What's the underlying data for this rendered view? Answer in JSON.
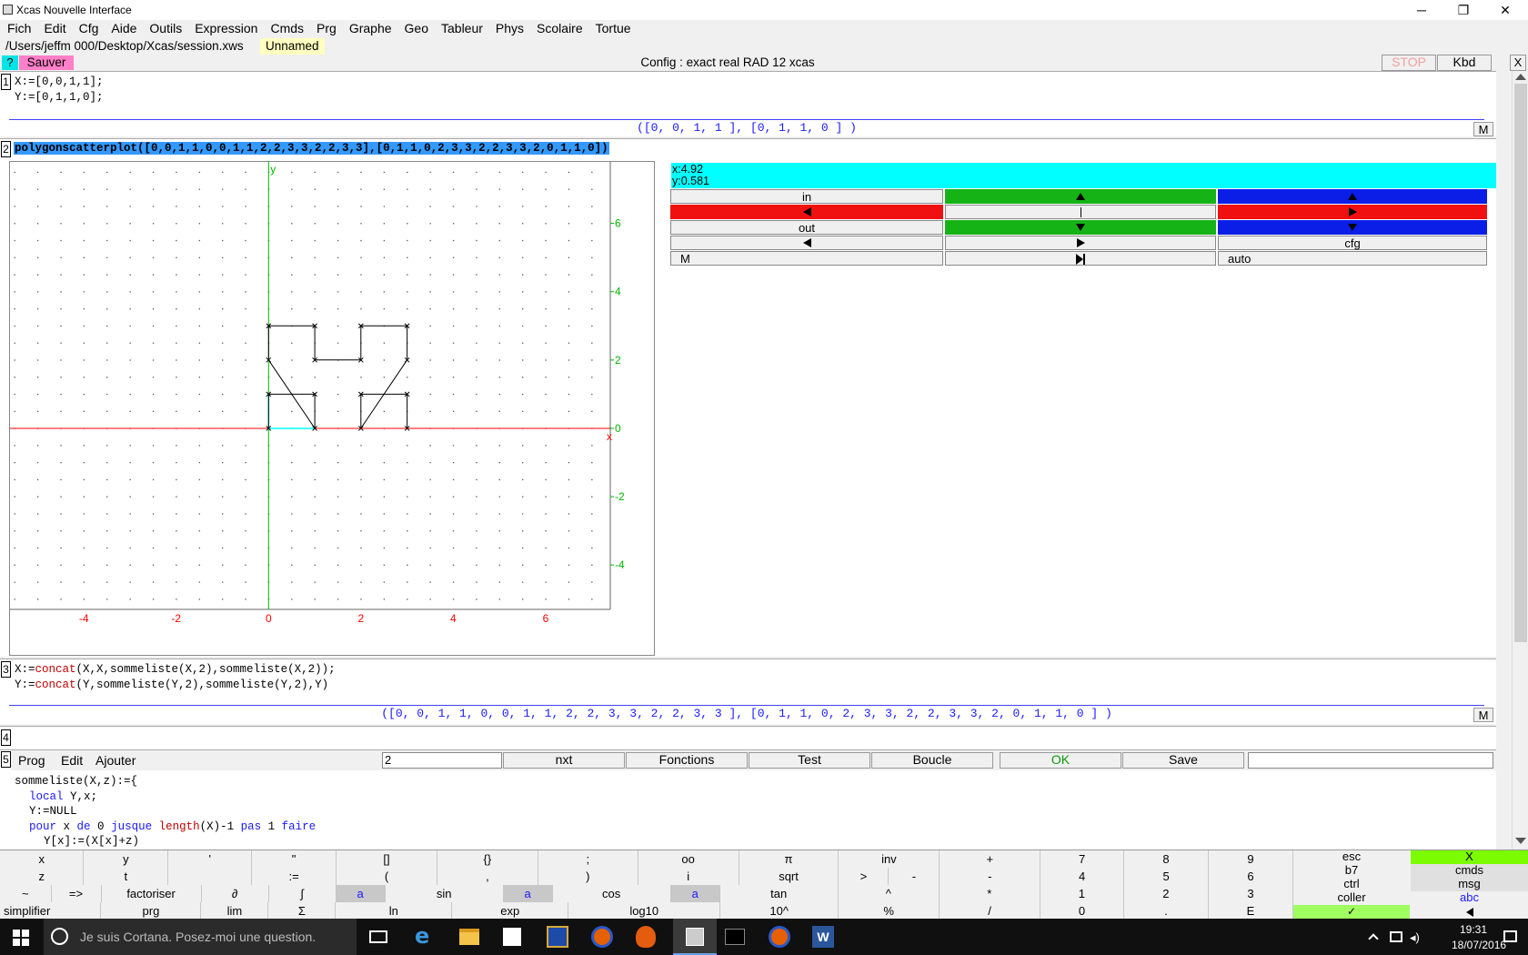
{
  "window": {
    "title": "Xcas Nouvelle Interface",
    "controls": [
      "─",
      "❐",
      "✕"
    ]
  },
  "menu": [
    "Fich",
    "Edit",
    "Cfg",
    "Aide",
    "Outils",
    "Expression",
    "Cmds",
    "Prg",
    "Graphe",
    "Geo",
    "Tableur",
    "Phys",
    "Scolaire",
    "Tortue"
  ],
  "session": {
    "path": "/Users/jeffm  000/Desktop/Xcas/session.xws",
    "name": "Unnamed"
  },
  "config": {
    "help": "?",
    "save": "Sauver",
    "text": "Config  : exact real RAD 12 xcas",
    "stop": "STOP",
    "kbd": "Kbd",
    "close": "X"
  },
  "levels": {
    "l1": {
      "num": "1",
      "line1": "X:=[0,0,1,1];",
      "line2": "Y:=[0,1,1,0];",
      "answer": "([0, 0, 1, 1 ], [0, 1, 1, 0 ] )",
      "m": "M"
    },
    "l2": {
      "num": "2",
      "cmd": "polygonscatterplot([0,0,1,1,0,0,1,1,2,2,3,3,2,2,3,3],[0,1,1,0,2,3,3,2,2,3,3,2,0,1,1,0])"
    },
    "l3": {
      "num": "3",
      "line1a": "X:=",
      "line1b": "concat",
      "line1c": "(X,X,sommeliste(X,2),sommeliste(X,2));",
      "line2a": "Y:=",
      "line2b": "concat",
      "line2c": "(Y,sommeliste(Y,2),sommeliste(Y,2),Y)",
      "answer": "([0, 0, 1, 1, 0, 0, 1, 1, 2, 2, 3, 3, 2, 2, 3, 3 ], [0, 1, 1, 0, 2, 3, 3, 2, 2, 3, 3, 2, 0, 1, 1, 0 ] )",
      "m": "M"
    },
    "l4": {
      "num": "4"
    },
    "l5": {
      "num": "5",
      "prog": "Prog",
      "edit": "Edit",
      "add": "Ajouter",
      "field": "2",
      "nxt": "nxt",
      "fonctions": "Fonctions",
      "test": "Test",
      "boucle": "Boucle",
      "ok": "OK",
      "save": "Save",
      "code": {
        "c1": "sommeliste(X,z):={",
        "c2a": "local",
        "c2b": " Y,x;",
        "c3": "Y:=NULL",
        "c4a": "pour",
        "c4b": " x ",
        "c4c": "de",
        "c4d": " 0 ",
        "c4e": "jusque",
        "c4f": " ",
        "c4g": "length",
        "c4h": "(X)-1 ",
        "c4i": "pas",
        "c4j": " 1 ",
        "c4k": "faire",
        "c5": "Y[x]:=(X[x]+z)"
      }
    }
  },
  "graph": {
    "coords": {
      "x": "x:4.92",
      "y": "y:0.581"
    },
    "x_ticks": [
      "-4",
      "-2",
      "0",
      "2",
      "4",
      "6"
    ],
    "y_ticks": [
      "6",
      "4",
      "2",
      "0",
      "-2",
      "-4"
    ],
    "x_label": "x",
    "y_label": "y",
    "controls": {
      "in": "in",
      "out": "out",
      "cfg": "cfg",
      "m": "M",
      "auto": "auto"
    },
    "colors": {
      "green": "#16b316",
      "blue": "#0b1ee8",
      "red": "#f01010",
      "cyan": "#00ffff"
    }
  },
  "chart_data": {
    "type": "line",
    "title": "",
    "xlim": [
      -5.6,
      7.4
    ],
    "ylim": [
      -5.3,
      7.8
    ],
    "series": [
      {
        "x": [
          0,
          0,
          1,
          1,
          0,
          0,
          1,
          1,
          2,
          2,
          3,
          3,
          2,
          2,
          3,
          3
        ],
        "y": [
          0,
          1,
          1,
          0,
          2,
          3,
          3,
          2,
          2,
          3,
          3,
          2,
          0,
          1,
          1,
          0
        ]
      }
    ]
  },
  "keyboard": {
    "row1": [
      "x",
      "y",
      "'",
      "\"",
      "[]",
      "{}",
      ";",
      "oo",
      "π",
      "inv",
      "+",
      "7",
      "8",
      "9"
    ],
    "row2": [
      "z",
      "t",
      "",
      "",
      "(",
      ",",
      ")",
      "i",
      "sqrt",
      ">",
      "-",
      "4",
      "5",
      "6"
    ],
    "row2b": {
      "assign": ":=",
      "minus2": "-"
    },
    "row3": [
      "~",
      "=>",
      "factoriser",
      "∂",
      "∫",
      "a",
      "sin",
      "a",
      "cos",
      "a",
      "tan",
      "^",
      "*",
      "1",
      "2",
      "3"
    ],
    "row4": [
      "simplifier",
      "prg",
      "lim",
      "Σ",
      "ln",
      "exp",
      "log10",
      "10^",
      "%",
      "/",
      "0",
      ".",
      "E"
    ],
    "side": {
      "esc": "esc",
      "X": "X",
      "b7": "b7",
      "cmds": "cmds",
      "ctrl": "ctrl",
      "msg": "msg",
      "coller": "coller",
      "abc": "abc",
      "check": "✓"
    }
  },
  "taskbar": {
    "search": "Je suis Cortana. Posez-moi une question.",
    "time": "19:31",
    "date": "18/07/2016"
  }
}
